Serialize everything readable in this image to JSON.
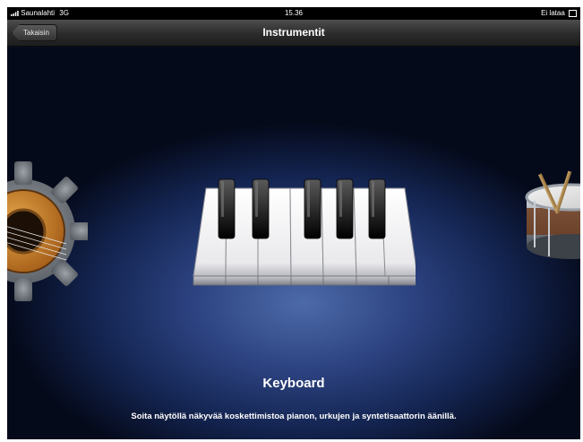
{
  "status_bar": {
    "carrier": "Saunalahti",
    "network": "3G",
    "time": "15.36",
    "charging": "Ei lataa"
  },
  "nav": {
    "back_label": "Takaisin",
    "title": "Instrumentit"
  },
  "instrument": {
    "name": "Keyboard",
    "description": "Soita näytöllä näkyvää koskettimistoa pianon, urkujen ja syntetisaattorin äänillä."
  },
  "icons": {
    "left": "guitar-gear-icon",
    "center": "piano-keyboard-icon",
    "right": "drum-icon"
  }
}
